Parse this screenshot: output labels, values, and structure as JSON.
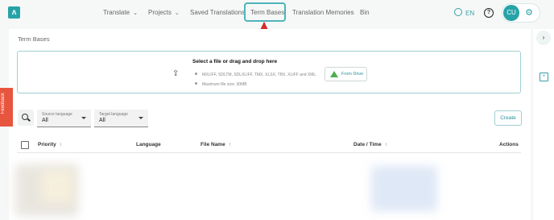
{
  "topbar": {
    "logo_text": "ʌ",
    "nav": {
      "translate": "Translate",
      "projects": "Projects",
      "saved_translations": "Saved Translations",
      "term_bases": "Term Bases",
      "translation_memories": "Translation Memories",
      "bin": "Bin"
    },
    "language": "EN",
    "help": "?",
    "avatar": "CU",
    "gear": "⚙"
  },
  "panel": {
    "title": "Term Bases",
    "dropzone": {
      "title": "Select a file or drag and drop here",
      "formats": "MXLIFF, SDLTM, SDLXLIFF, TMX, XLSX, TBX, XLIFF and XML.",
      "max_size": "Maximum file size: 30MB",
      "drive_button": "From Drive"
    },
    "filters": {
      "source_label": "Source language",
      "source_value": "All",
      "target_label": "Target language",
      "target_value": "All"
    },
    "create": "Create",
    "table": {
      "headers": {
        "priority": "Priority",
        "language": "Language",
        "file_name": "File Name",
        "date_time": "Date / Time",
        "actions": "Actions"
      }
    }
  },
  "feedback": "Feedback",
  "colors": {
    "accent": "#27a3a8",
    "highlight": "#4fb3ba",
    "arrow": "#d62b2b",
    "feedback": "#e8553f"
  },
  "icons": [
    "logo-icon",
    "chevron-down-icon",
    "globe-icon",
    "help-icon",
    "gear-icon",
    "upload-icon",
    "google-drive-icon",
    "search-icon",
    "sort-up-icon",
    "expand-icon",
    "note-icon"
  ]
}
